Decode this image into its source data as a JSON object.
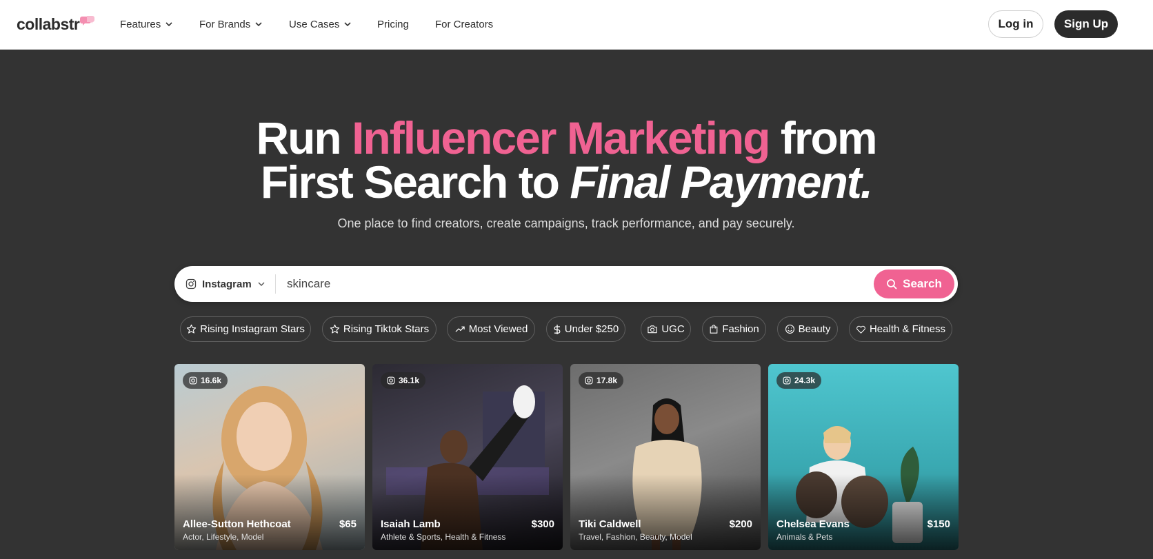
{
  "nav": {
    "logo": "collabstr",
    "items": [
      {
        "label": "Features",
        "dropdown": true
      },
      {
        "label": "For Brands",
        "dropdown": true
      },
      {
        "label": "Use Cases",
        "dropdown": true
      },
      {
        "label": "Pricing",
        "dropdown": false
      },
      {
        "label": "For Creators",
        "dropdown": false
      }
    ],
    "login": "Log in",
    "signup": "Sign Up"
  },
  "hero": {
    "line1_a": "Run ",
    "line1_pink": "Influencer Marketing",
    "line1_b": " from",
    "line2_a": "First Search to ",
    "line2_italic": "Final Payment.",
    "subtitle": "One place to find creators, create campaigns, track performance, and pay securely."
  },
  "search": {
    "platform": "Instagram",
    "platform_icon": "instagram-icon",
    "value": "skincare",
    "button": "Search"
  },
  "chips": [
    {
      "label": "Rising Instagram Stars",
      "icon": "star-icon"
    },
    {
      "label": "Rising Tiktok Stars",
      "icon": "star-icon"
    },
    {
      "label": "Most Viewed",
      "icon": "trending-up-icon"
    },
    {
      "label": "Under $250",
      "icon": "dollar-icon"
    },
    {
      "label": "UGC",
      "icon": "camera-icon"
    },
    {
      "label": "Fashion",
      "icon": "shopping-bag-icon"
    },
    {
      "label": "Beauty",
      "icon": "smile-icon"
    },
    {
      "label": "Health & Fitness",
      "icon": "heart-icon"
    }
  ],
  "creators": [
    {
      "followers": "16.6k",
      "name": "Allee-Sutton Hethcoat",
      "price": "$65",
      "tags": "Actor, Lifestyle, Model"
    },
    {
      "followers": "36.1k",
      "name": "Isaiah Lamb",
      "price": "$300",
      "tags": "Athlete & Sports, Health & Fitness"
    },
    {
      "followers": "17.8k",
      "name": "Tiki Caldwell",
      "price": "$200",
      "tags": "Travel, Fashion, Beauty, Model"
    },
    {
      "followers": "24.3k",
      "name": "Chelsea Evans",
      "price": "$150",
      "tags": "Animals & Pets"
    }
  ],
  "colors": {
    "accent_pink": "#f06292",
    "background_dark": "#333333",
    "nav_bg": "#ffffff",
    "button_dark": "#2b2b2b"
  }
}
